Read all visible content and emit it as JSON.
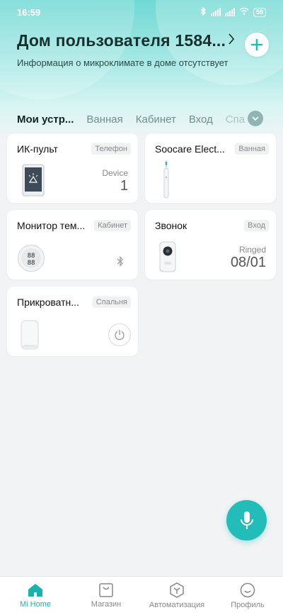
{
  "status_bar": {
    "time": "16:59",
    "battery": "59"
  },
  "header": {
    "title": "Дом пользователя 1584...",
    "subtitle": "Информация о микроклимате в доме отсутствует"
  },
  "tabs": [
    {
      "label": "Мои устр..."
    },
    {
      "label": "Ванная"
    },
    {
      "label": "Кабинет"
    },
    {
      "label": "Вход"
    },
    {
      "label": "Спа"
    }
  ],
  "devices": [
    {
      "title": "ИК-пульт",
      "tag": "Телефон",
      "status_label": "Device",
      "status_value": "1",
      "icon": "phone-remote-icon"
    },
    {
      "title": "Soocare Elect...",
      "tag": "Ванная",
      "icon": "toothbrush-icon"
    },
    {
      "title": "Монитор тем...",
      "tag": "Кабинет",
      "icon": "thermometer-monitor-icon",
      "extra_icon": "bluetooth-icon"
    },
    {
      "title": "Звонок",
      "tag": "Вход",
      "status_label": "Ringed",
      "status_value": "08/01",
      "icon": "doorbell-icon"
    },
    {
      "title": "Прикроватн...",
      "tag": "Спальня",
      "icon": "bedside-lamp-icon",
      "extra_icon": "power-icon"
    }
  ],
  "bottom_nav": [
    {
      "label": "Mi Home",
      "icon": "home-icon",
      "active": true
    },
    {
      "label": "Магазин",
      "icon": "store-icon"
    },
    {
      "label": "Автоматизация",
      "icon": "automation-icon"
    },
    {
      "label": "Профиль",
      "icon": "profile-icon"
    }
  ],
  "colors": {
    "accent": "#22bdb8",
    "active_nav": "#1ab2ae"
  }
}
